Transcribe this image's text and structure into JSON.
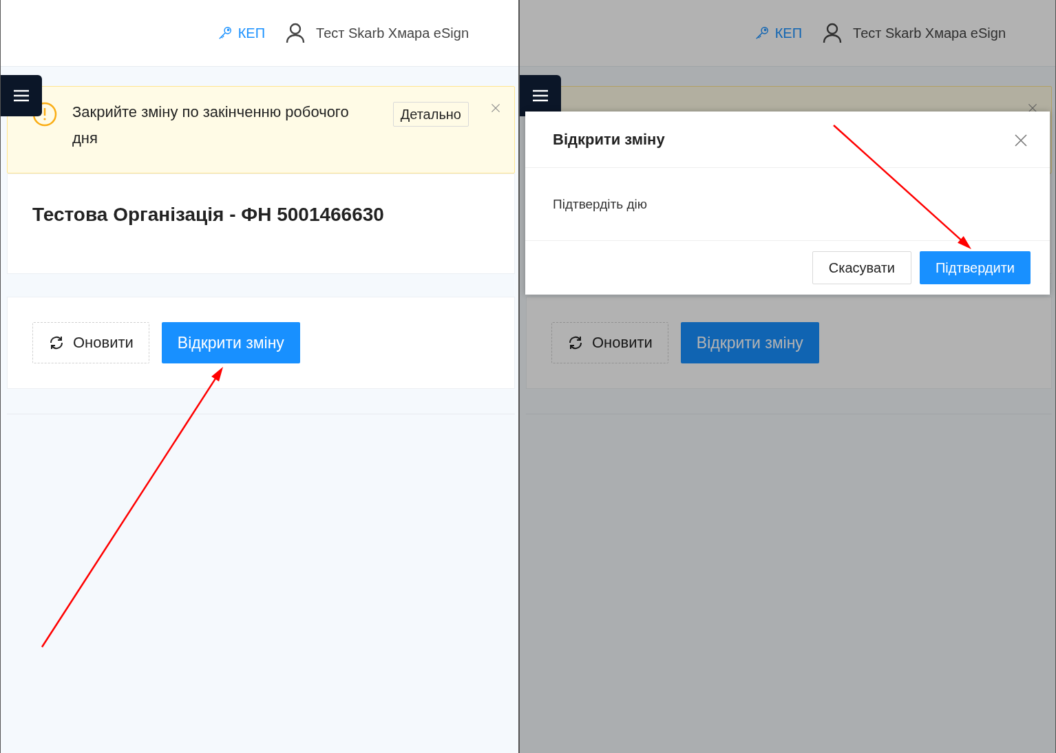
{
  "screens": [
    {
      "header": {
        "kep_link": "КЕП",
        "user_name": "Тест Skarb Хмара eSign"
      },
      "alert": {
        "message": "Закрийте зміну по закінченню робочого дня",
        "details_button": "Детально"
      },
      "org_title": "Тестова Організація - ФН 5001466630",
      "actions": [
        {
          "kind": "refresh",
          "label": "Оновити"
        },
        {
          "kind": "primary",
          "label": "Відкрити зміну"
        }
      ],
      "dimmed": false
    },
    {
      "header": {
        "kep_link": "КЕП",
        "user_name": "Тест Skarb Хмара eSign"
      },
      "actions": [
        {
          "kind": "refresh",
          "label": "Оновити"
        },
        {
          "kind": "primary",
          "label": "Відкрити зміну"
        }
      ],
      "dimmed": true,
      "modal": {
        "title": "Відкрити зміну",
        "body": "Підтвердіть дію",
        "buttons": [
          {
            "kind": "default",
            "label": "Скасувати"
          },
          {
            "kind": "primary",
            "label": "Підтвердити"
          }
        ]
      }
    }
  ]
}
